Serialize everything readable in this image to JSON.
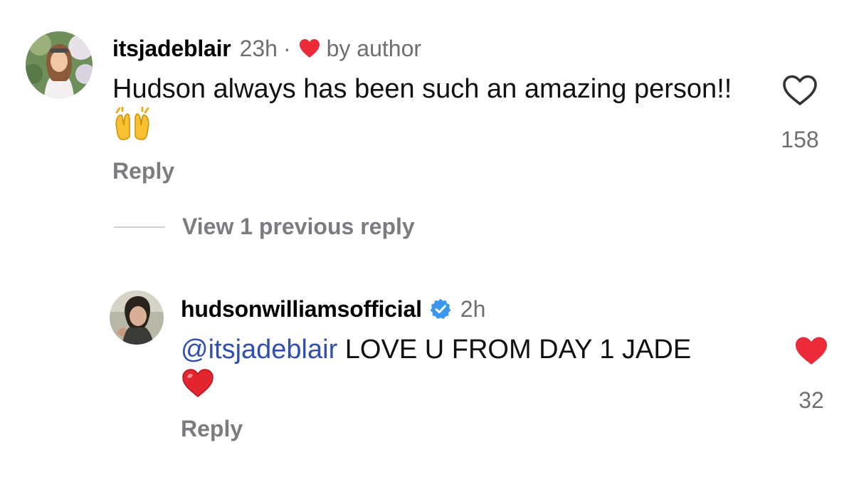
{
  "comments": [
    {
      "username": "itsjadeblair",
      "time": "23h",
      "separator": "·",
      "author_like_label": "by author",
      "text": "Hudson always has been such an amazing person!!",
      "emoji": "raising-hands",
      "reply_label": "Reply",
      "like_count": "158",
      "liked": false
    }
  ],
  "view_previous_label": "View 1 previous reply",
  "replies": [
    {
      "username": "hudsonwilliamsofficial",
      "verified": true,
      "time": "2h",
      "mention": "@itsjadeblair",
      "text": " LOVE U FROM DAY 1 JADE",
      "emoji": "red-heart",
      "reply_label": "Reply",
      "like_count": "32",
      "liked": true
    }
  ],
  "colors": {
    "heart_red": "#ed2a3a",
    "mention": "#2f4fb1",
    "muted": "#6e6e73",
    "verified_blue": "#3897f0"
  },
  "icons": [
    "heart-outline-icon",
    "heart-filled-icon",
    "verified-badge-icon",
    "author-heart-icon"
  ]
}
